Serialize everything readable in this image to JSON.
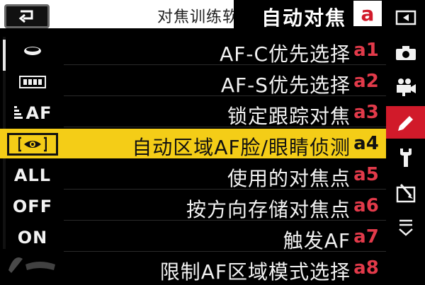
{
  "caption": "对焦训练软件",
  "header": {
    "title": "自动对焦",
    "code": "a"
  },
  "menu": {
    "items": [
      {
        "code": "a1",
        "label": "AF-C优先选择",
        "value_icon": "shutter-release-priority-icon",
        "value": ""
      },
      {
        "code": "a2",
        "label": "AF-S优先选择",
        "value_icon": "focus-priority-icon",
        "value": ""
      },
      {
        "code": "a3",
        "label": "锁定跟踪对焦",
        "value_icon": "af-blocked-shot-icon",
        "value": "AF"
      },
      {
        "code": "a4",
        "label": "自动区域AF脸/眼睛侦测",
        "value_icon": "face-eye-detection-icon",
        "value": ""
      },
      {
        "code": "a5",
        "label": "使用的对焦点",
        "value_icon": "",
        "value": "ALL"
      },
      {
        "code": "a6",
        "label": "按方向存储对焦点",
        "value_icon": "",
        "value": "OFF"
      },
      {
        "code": "a7",
        "label": "触发AF",
        "value_icon": "",
        "value": "ON"
      },
      {
        "code": "a8",
        "label": "限制AF区域模式选择",
        "value_icon": "",
        "value": ""
      }
    ],
    "selected_index": 3
  },
  "tabs": [
    {
      "name": "playback-icon"
    },
    {
      "name": "camera-icon"
    },
    {
      "name": "movie-camera-icon"
    },
    {
      "name": "pencil-icon",
      "active": true
    },
    {
      "name": "wrench-icon"
    },
    {
      "name": "retouch-icon"
    },
    {
      "name": "my-menu-icon"
    }
  ],
  "colors": {
    "accent_red": "#d11a2a",
    "selection_yellow": "#f4cd17",
    "code_red": "#e23a4a"
  }
}
